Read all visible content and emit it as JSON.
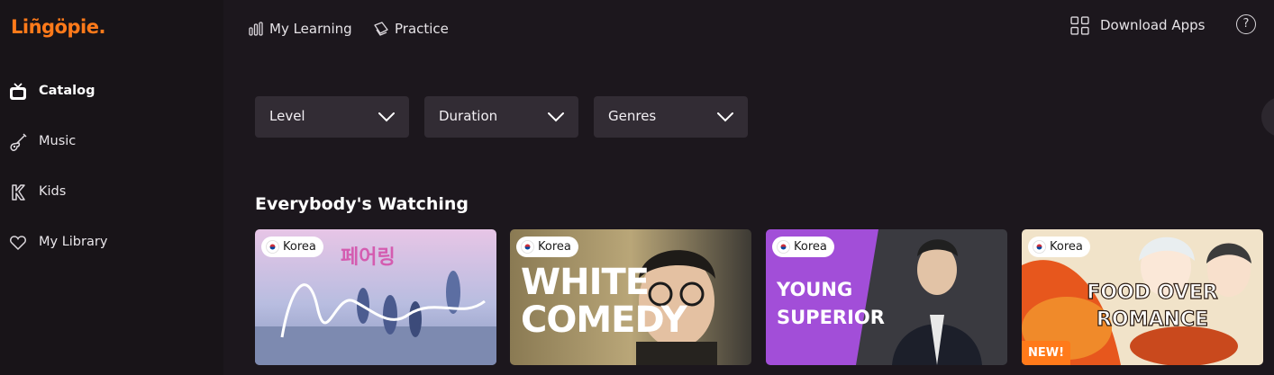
{
  "brand": {
    "logo": "Liñgöpie.",
    "accent": "#ff7a1a"
  },
  "sidebar": {
    "items": [
      {
        "label": "Catalog",
        "icon": "tv-icon",
        "active": true
      },
      {
        "label": "Music",
        "icon": "guitar-icon",
        "active": false
      },
      {
        "label": "Kids",
        "icon": "kids-icon",
        "active": false
      },
      {
        "label": "My Library",
        "icon": "heart-icon",
        "active": false
      }
    ]
  },
  "topnav": {
    "my_learning": "My Learning",
    "practice": "Practice",
    "download_apps": "Download Apps",
    "help": "?"
  },
  "filters": [
    {
      "label": "Level"
    },
    {
      "label": "Duration"
    },
    {
      "label": "Genres"
    }
  ],
  "section": {
    "title": "Everybody's Watching",
    "cards": [
      {
        "tag": "Korea",
        "title_art": "",
        "new": ""
      },
      {
        "tag": "Korea",
        "title_art": "WHITE COMEDY",
        "new": ""
      },
      {
        "tag": "Korea",
        "title_art": "YOUNG SUPERIOR",
        "new": ""
      },
      {
        "tag": "Korea",
        "title_art": "FOOD OVER ROMANCE",
        "new": "NEW!"
      }
    ]
  }
}
